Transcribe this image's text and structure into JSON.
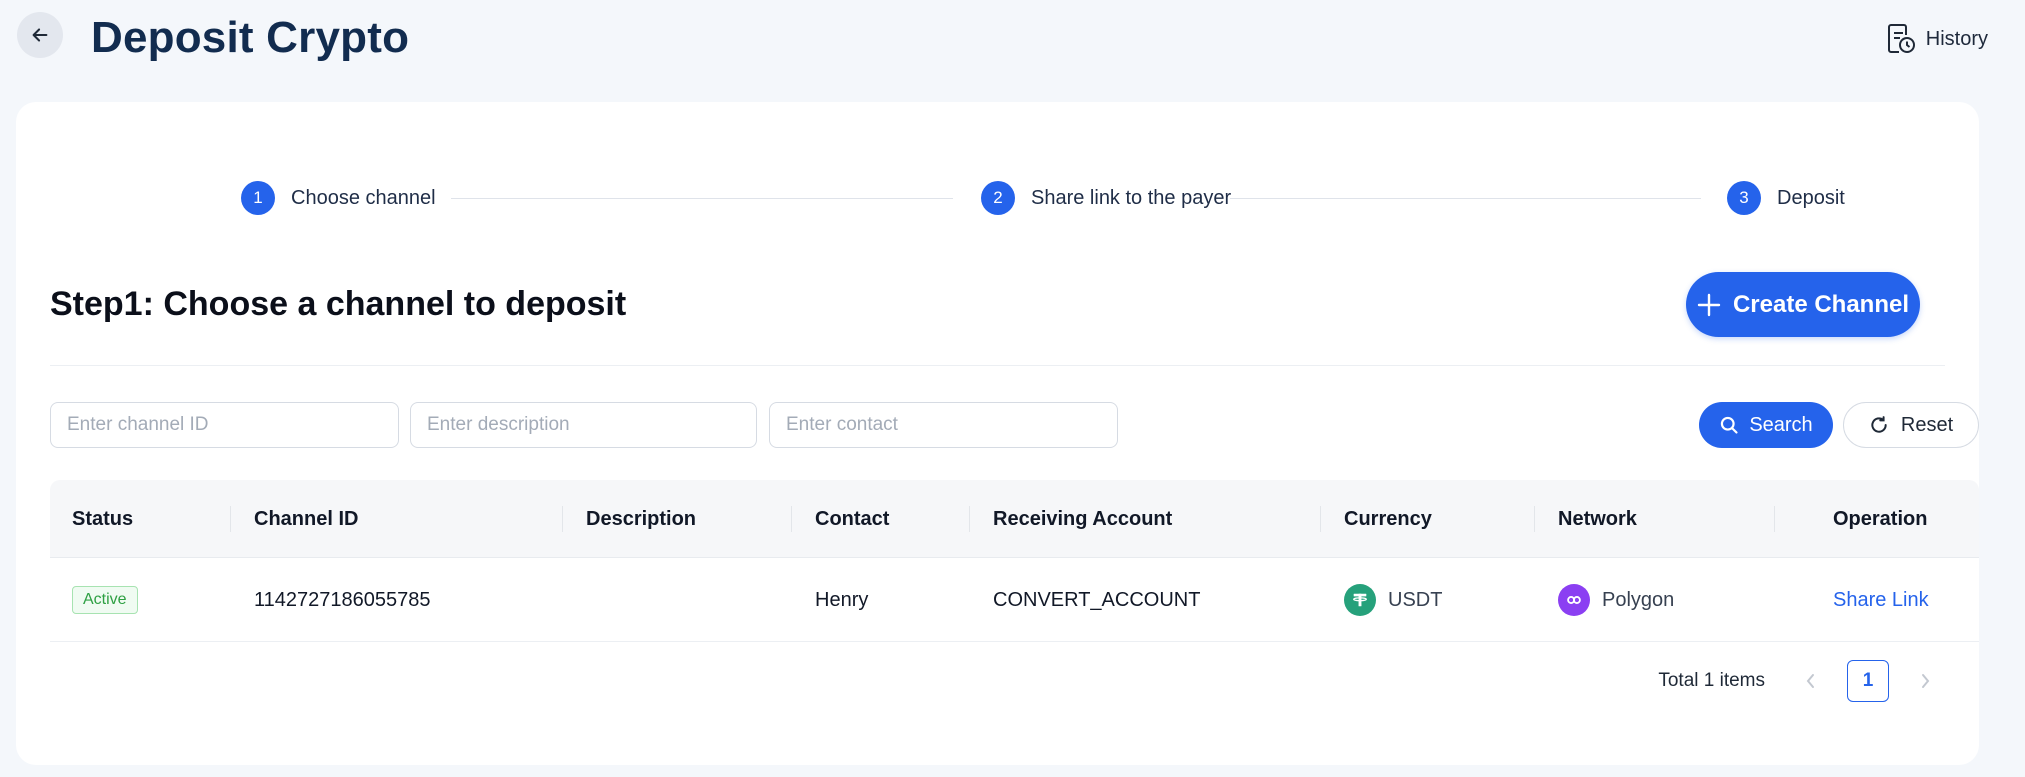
{
  "header": {
    "title": "Deposit Crypto",
    "history_label": "History"
  },
  "steps": [
    {
      "num": "1",
      "label": "Choose channel"
    },
    {
      "num": "2",
      "label": "Share link to the payer"
    },
    {
      "num": "3",
      "label": "Deposit"
    }
  ],
  "section": {
    "title": "Step1: Choose a channel to deposit",
    "create_label": "Create Channel"
  },
  "filters": {
    "channel_id_placeholder": "Enter channel ID",
    "description_placeholder": "Enter description",
    "contact_placeholder": "Enter contact",
    "search_label": "Search",
    "reset_label": "Reset"
  },
  "table": {
    "columns": [
      "Status",
      "Channel ID",
      "Description",
      "Contact",
      "Receiving Account",
      "Currency",
      "Network",
      "Operation"
    ],
    "rows": [
      {
        "status": "Active",
        "channel_id": "1142727186055785",
        "description": "",
        "contact": "Henry",
        "receiving_account": "CONVERT_ACCOUNT",
        "currency": "USDT",
        "network": "Polygon",
        "operation": "Share Link"
      }
    ]
  },
  "pagination": {
    "total_label": "Total 1 items",
    "current_page": "1"
  },
  "colors": {
    "primary": "#2563eb",
    "title": "#122c4f",
    "active_green": "#2ea043",
    "usdt": "#26a17b",
    "polygon": "#8b3ff2"
  }
}
